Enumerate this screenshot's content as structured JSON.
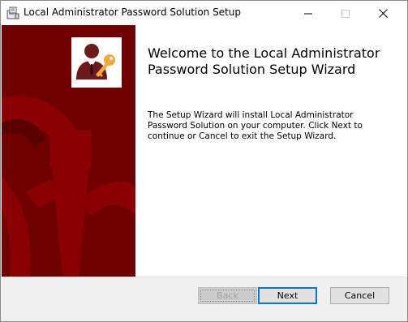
{
  "window": {
    "title": "Local Administrator Password Solution Setup",
    "icon": "installer-icon"
  },
  "titlebar_controls": {
    "minimize_icon": "minimize-icon",
    "maximize_icon": "maximize-icon",
    "close_icon": "close-icon"
  },
  "banner": {
    "logo_icon": "admin-key-icon",
    "background_color": "#6f0000",
    "accent_color": "#8b0000"
  },
  "content": {
    "heading": "Welcome to the Local Administrator Password Solution Setup Wizard",
    "description": "The Setup Wizard will install Local Administrator Password Solution on your computer. Click Next to continue or Cancel to exit the Setup Wizard."
  },
  "buttons": {
    "back_label": "Back",
    "next_label": "Next",
    "cancel_label": "Cancel",
    "back_enabled": false,
    "default_button": "Next"
  },
  "colors": {
    "focus_border": "#0078d7",
    "footer_bg": "#f0f0f0",
    "logo_figure": "#6f1a1a",
    "logo_key": "#f2a93b"
  }
}
